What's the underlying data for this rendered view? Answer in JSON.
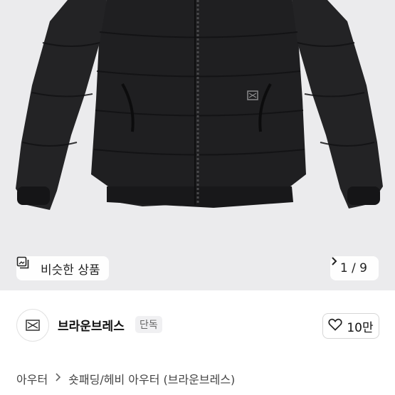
{
  "hero": {
    "similar_products_label": "비슷한 상품",
    "image_counter": "1 / 9"
  },
  "brand": {
    "name": "브라운브레스",
    "badge": "단독",
    "like_count": "10만"
  },
  "breadcrumb": {
    "category": "아우터",
    "subcategory": "숏패딩/헤비 아우터 (브라운브레스)"
  },
  "colors": {
    "background": "#ebebed",
    "jacket": "#1f1f21"
  },
  "icons": [
    "similar-products-icon",
    "chevron-right-icon",
    "heart-icon",
    "brand-logo"
  ]
}
